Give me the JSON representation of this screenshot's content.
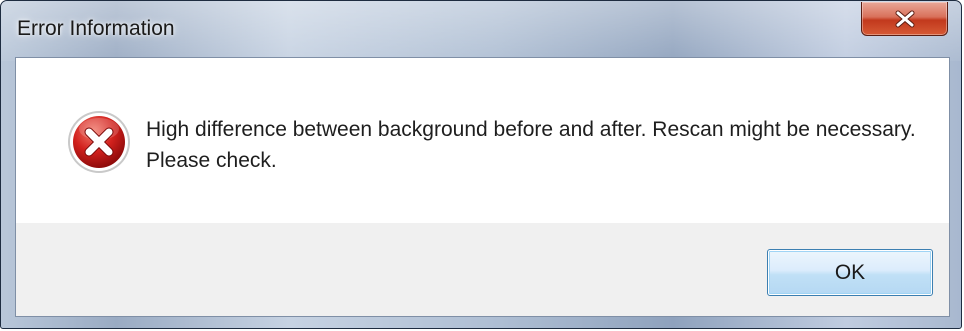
{
  "window": {
    "title": "Error Information",
    "close_icon": "close-x-icon"
  },
  "dialog": {
    "icon": "error-icon",
    "message": "High difference between background before and after. Rescan might be necessary. Please check.",
    "ok_label": "OK"
  },
  "colors": {
    "close_button": "#c2391d",
    "error_icon": "#d2211d",
    "button_area": "#f0f0f0",
    "ok_border": "#3c7fb1"
  }
}
